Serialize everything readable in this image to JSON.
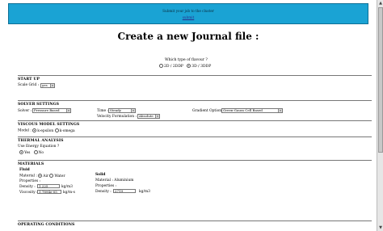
{
  "banner": {
    "message": "Submit your job to the cluster",
    "link": "submit"
  },
  "page_title": "Create a new Journal file :",
  "flavour": {
    "question": "Which type of flavour ?",
    "options": [
      "2D / 2DDP",
      "3D / 3DDP"
    ],
    "selected": 1
  },
  "start_up": {
    "heading": "START UP",
    "scale_grid_label": "Scale Grid :",
    "scale_grid_value": "yes"
  },
  "solver_settings": {
    "heading": "SOLVER SETTINGS",
    "solver_label": "Solver :",
    "solver_value": "Pressure Based",
    "time_label": "Time :",
    "time_value": "Steady",
    "velocity_label": "Velocity Formulation :",
    "velocity_value": "Absolute",
    "gradient_label": "Gradient Option :",
    "gradient_value": "Green-Gauss Cell Based"
  },
  "viscous": {
    "heading": "VISCOUS MODEL SETTINGS",
    "model_label": "Model :",
    "options": [
      "k-epsilon",
      "k-omega"
    ],
    "selected": 0
  },
  "thermal": {
    "heading": "THERMAL ANALYSIS",
    "question": "Use Energy Equation ?",
    "options": [
      "Yes",
      "No"
    ],
    "selected": 0
  },
  "materials": {
    "heading": "MATERIALS",
    "fluid": {
      "label": "Fluid",
      "material_label": "Material :",
      "options": [
        "Air",
        "Water"
      ],
      "selected": 0,
      "properties_label": "Properties :",
      "density_label": "Density :",
      "density_value": "1.225",
      "density_unit": "kg/m3",
      "viscosity_label": "Viscosity :",
      "viscosity_value": "1.7894e-05",
      "viscosity_unit": "kg/m-s"
    },
    "solid": {
      "label": "Solid",
      "material_label": "Material : Aluminium",
      "properties_label": "Properties :",
      "density_label": "Density :",
      "density_value": "2719",
      "density_unit": "kg/m3"
    }
  },
  "operating": {
    "heading": "OPERATING CONDITIONS"
  },
  "icons": {
    "dropdown": "chevron-down-icon",
    "scroll_up": "arrow-up-icon",
    "scroll_down": "arrow-down-icon"
  }
}
